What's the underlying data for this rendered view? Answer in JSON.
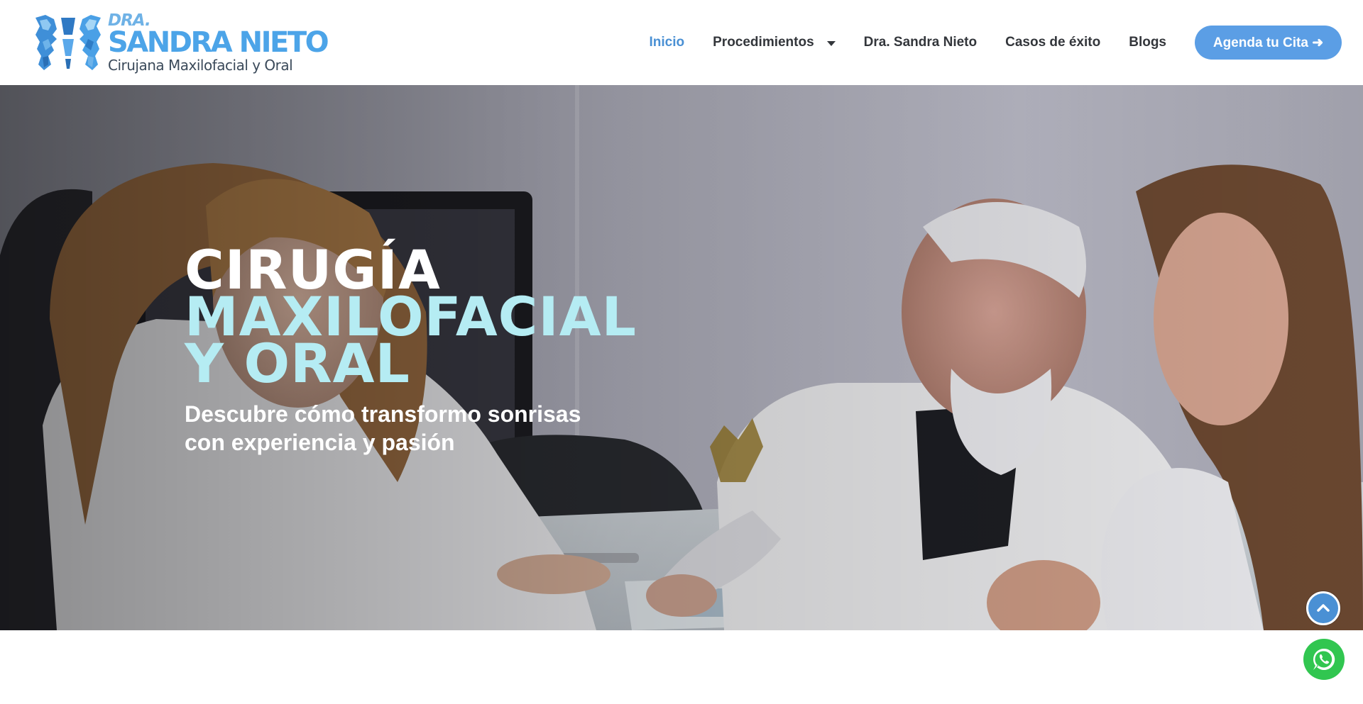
{
  "header": {
    "logo": {
      "line1": "DRA.",
      "line2": "SANDRA NIETO",
      "line3": "Cirujana Maxilofacial y Oral"
    },
    "nav": {
      "items": [
        {
          "label": "Inicio",
          "active": true
        },
        {
          "label": "Procedimientos",
          "has_dropdown": true
        },
        {
          "label": "Dra. Sandra Nieto"
        },
        {
          "label": "Casos de éxito"
        },
        {
          "label": "Blogs"
        }
      ],
      "cta_label": "Agenda tu Cita ➜"
    }
  },
  "hero": {
    "title_lines": [
      "CIRUGÍA",
      "MAXILOFACIAL",
      "Y ORAL"
    ],
    "subtitle_lines": [
      "Descubre cómo transformo sonrisas",
      "con experiencia y pasión"
    ]
  },
  "floating": {
    "scroll_top_icon": "chevron-up-icon",
    "whatsapp_icon": "whatsapp-icon"
  },
  "colors": {
    "accent": "#4a90d4",
    "cta_bg": "#5b9ee5",
    "logo_blue": "#4ca4e8",
    "hero_title_primary": "#ffffff",
    "hero_title_secondary": "#b5ecf3",
    "nav_text": "#33363b",
    "whatsapp_green": "#31c650"
  }
}
